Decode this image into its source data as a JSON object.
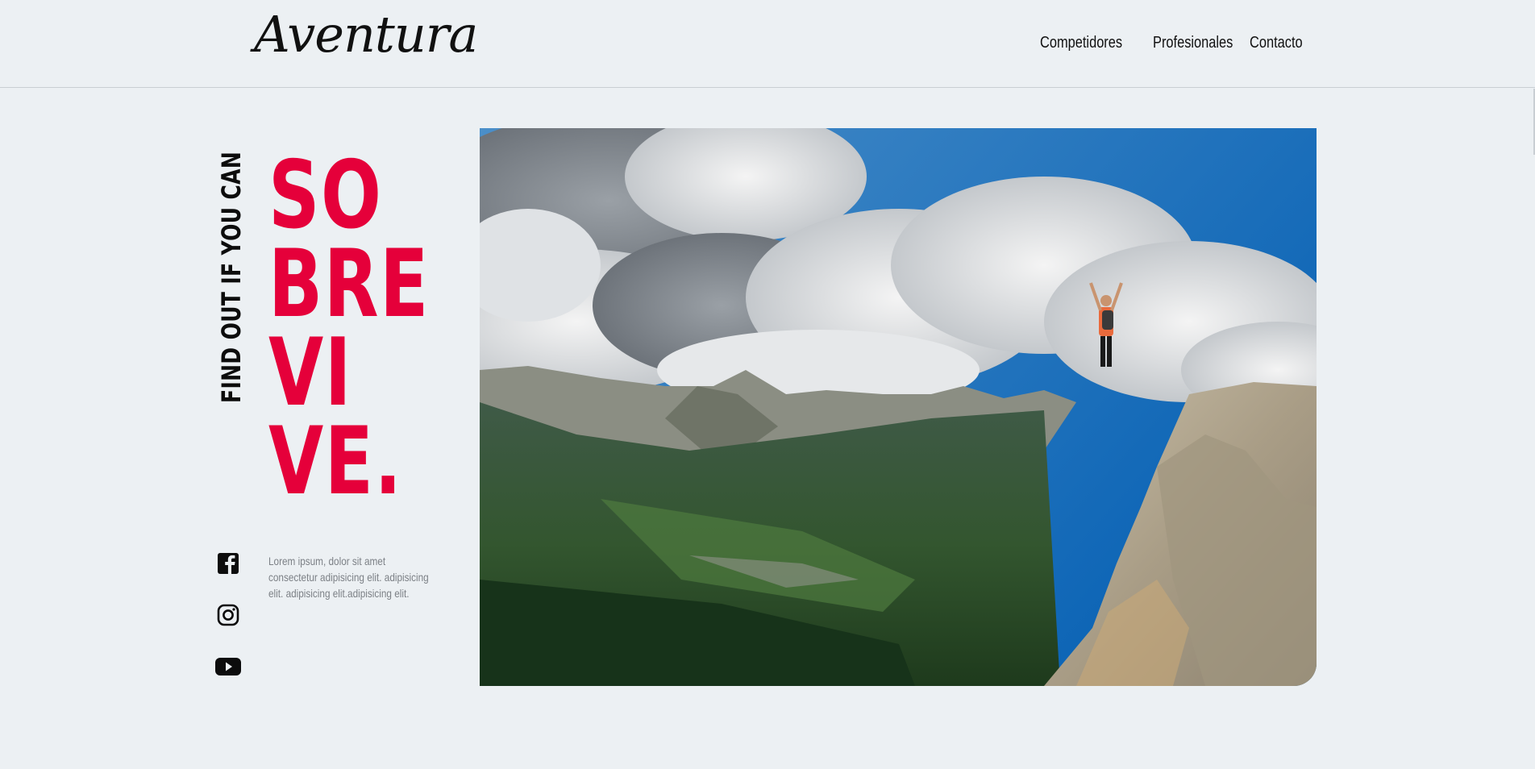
{
  "header": {
    "logo": "Aventura",
    "nav": [
      {
        "label": "Competidores"
      },
      {
        "label": "Profesionales"
      },
      {
        "label": "Contacto"
      }
    ]
  },
  "hero": {
    "tagline": "FIND OUT IF YOU CAN",
    "headline_lines": [
      "SO",
      "BRE",
      "VI",
      "VE."
    ],
    "description": "Lorem ipsum, dolor sit amet consectetur adipisicing elit. adipisicing elit. adipisicing elit.adipisicing elit.",
    "image_alt": "hiker-on-mountain-summit"
  },
  "social": [
    {
      "icon": "facebook-icon"
    },
    {
      "icon": "instagram-icon"
    },
    {
      "icon": "youtube-icon"
    }
  ],
  "colors": {
    "background": "#ecf0f3",
    "accent": "#e5003a",
    "text": "#111111",
    "muted": "#7c8086"
  }
}
